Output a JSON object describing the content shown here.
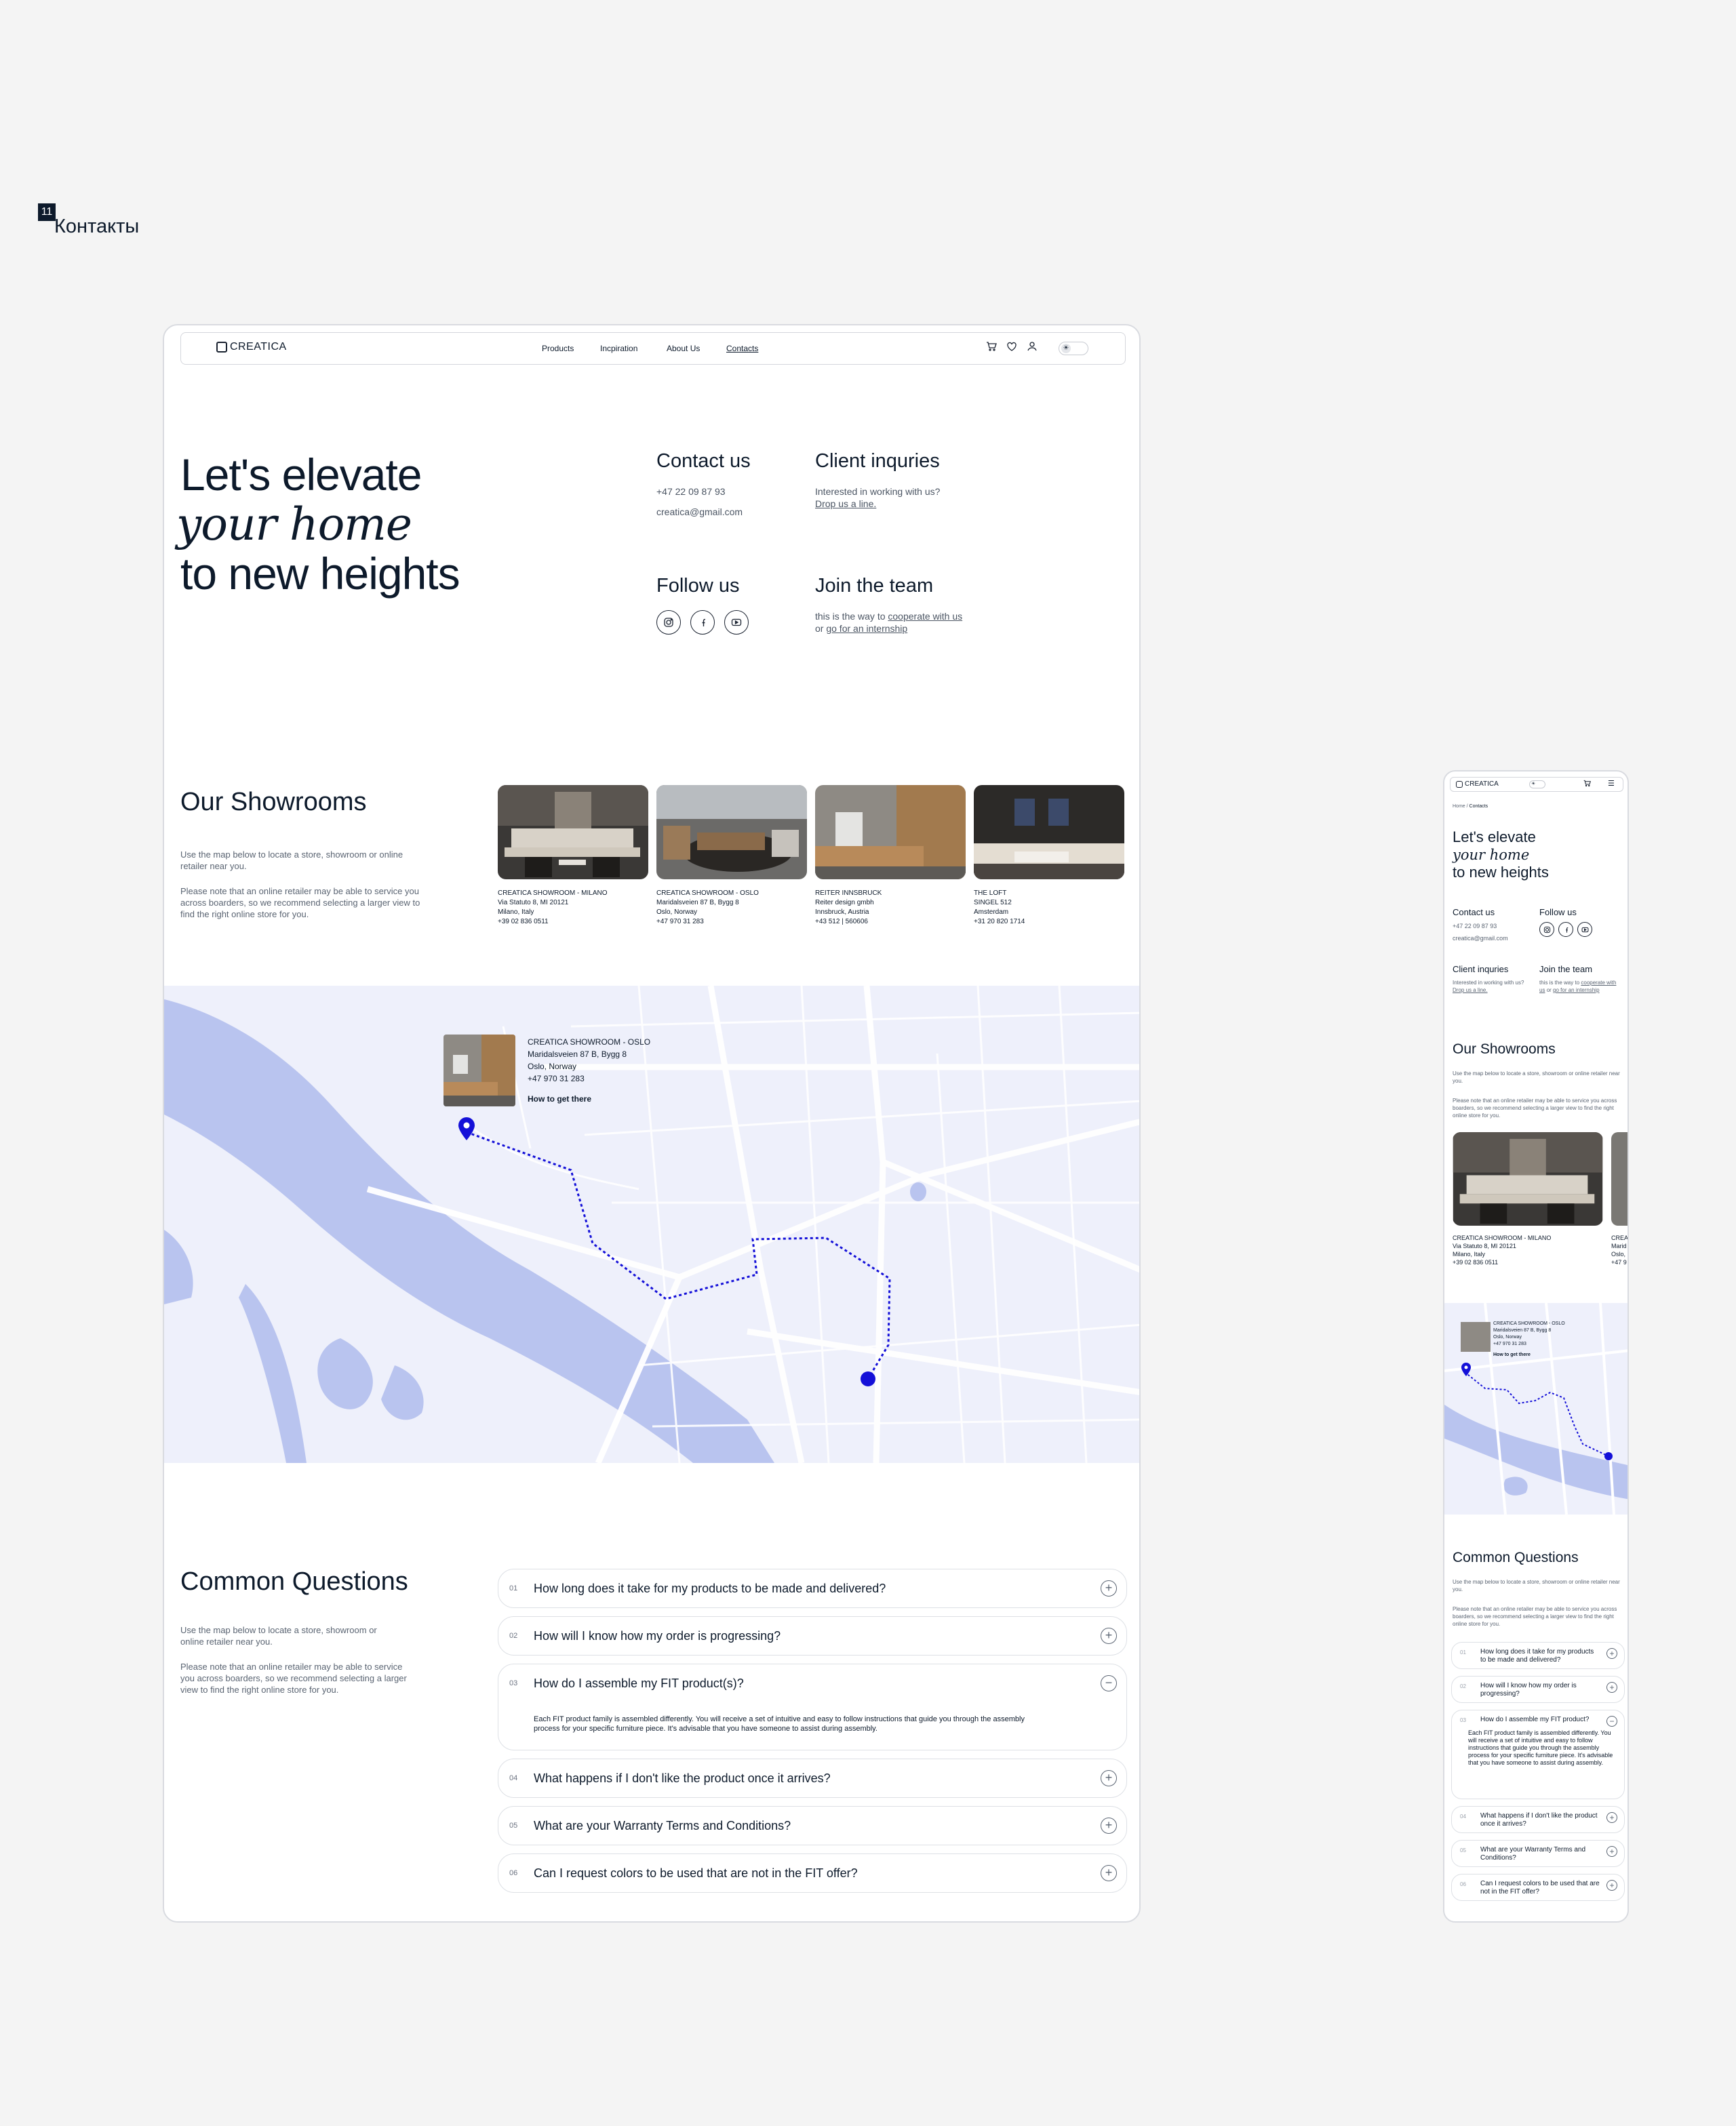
{
  "section": {
    "number": "11",
    "title": "Контакты"
  },
  "desktop": {
    "nav": {
      "logo": "CREATICA",
      "links": [
        "Products",
        "Incpiration",
        "About Us",
        "Contacts"
      ]
    },
    "hero": {
      "line1": "Let's elevate",
      "line2": "your home",
      "line3": "to new heights"
    },
    "contact": {
      "title": "Contact us",
      "phone": "+47 22 09 87 93",
      "email": "creatica@gmail.com"
    },
    "client": {
      "title": "Client inquries",
      "text": "Interested in working with us?",
      "link": "Drop us a line."
    },
    "follow": {
      "title": "Follow us"
    },
    "join": {
      "title": "Join the team",
      "text1": "this is the way to",
      "link1": "cooperate with us",
      "text2": "or",
      "link2": "go for an internship"
    },
    "showrooms": {
      "title": "Our Showrooms",
      "p1": "Use the map below to locate a store, showroom or online retailer near you.",
      "p2": "Please note that an online retailer may be able to service you across boarders, so we recommend selecting a larger view to find the right online store for you.",
      "cards": [
        {
          "name": "CREATICA SHOWROOM - MILANO",
          "l1": "Via Statuto 8, MI 20121",
          "l2": "Milano, Italy",
          "l3": "+39 02 836 0511"
        },
        {
          "name": "CREATICA SHOWROOM - OSLO",
          "l1": "Maridalsveien 87 B, Bygg 8",
          "l2": "Oslo, Norway",
          "l3": "+47 970 31 283"
        },
        {
          "name": "REITER INNSBRUCK",
          "l1": "Reiter design gmbh",
          "l2": "Innsbruck, Austria",
          "l3": "+43 512 | 560606"
        },
        {
          "name": "THE LOFT",
          "l1": "SINGEL 512",
          "l2": "Amsterdam",
          "l3": "+31 20 820 1714"
        }
      ]
    },
    "map": {
      "popup": {
        "name": "CREATICA SHOWROOM - OSLO",
        "l1": "Maridalsveien 87 B, Bygg 8",
        "l2": "Oslo, Norway",
        "l3": "+47 970 31 283",
        "cta": "How to get there"
      },
      "route_color": "#1410d8",
      "water_color": "#b9c4ef"
    },
    "faq": {
      "title": "Common Questions",
      "p1": "Use the map below to locate a store, showroom or online retailer near you.",
      "p2": "Please note that an online retailer may be able to service you across boarders, so we recommend selecting a larger view to find the right online store for you.",
      "items": [
        {
          "num": "01",
          "q": "How long does it take for my products to be made and delivered?"
        },
        {
          "num": "02",
          "q": "How will I know how my order is progressing?"
        },
        {
          "num": "03",
          "q": "How do I assemble my FIT product(s)?",
          "a": "Each FIT product family is assembled differently. You will receive a set of intuitive and easy to follow instructions that guide you through the assembly process for your specific furniture piece. It's advisable that you have someone to assist during assembly."
        },
        {
          "num": "04",
          "q": "What happens if I don't like the product once it arrives?"
        },
        {
          "num": "05",
          "q": "What are your Warranty Terms and Conditions?"
        },
        {
          "num": "06",
          "q": "Can I request colors to be used that are not in the FIT offer?"
        }
      ]
    }
  },
  "mobile": {
    "logo": "CREATICA",
    "breadcrumb": {
      "home": "Home",
      "sep": "/",
      "current": "Contacts"
    },
    "hero": {
      "line1": "Let's elevate",
      "line2": "your home",
      "line3": "to new heights"
    },
    "contact": {
      "title": "Contact us",
      "phone": "+47 22 09 87 93",
      "email": "creatica@gmail.com"
    },
    "follow": {
      "title": "Follow us"
    },
    "client": {
      "title": "Client inquries",
      "text": "Interested in working with us?",
      "link": "Drop us a line."
    },
    "join": {
      "title": "Join the team",
      "text1": "this is the way to",
      "link1": "cooperate with us",
      "text2": "or",
      "link2": "go for an internship"
    },
    "showrooms": {
      "title": "Our Showrooms",
      "p1": "Use the map below to locate a store, showroom or online retailer near you.",
      "p2": "Please note that an online retailer may be able to service you across boarders, so we recommend selecting a larger view to find the right online store for you.",
      "card": {
        "name": "CREATICA SHOWROOM - MILANO",
        "l1": "Via Statuto 8, MI 20121",
        "l2": "Milano, Italy",
        "l3": "+39 02 836 0511"
      },
      "peek": {
        "name": "CREA",
        "l1": "Marid",
        "l2": "Oslo,",
        "l3": "+47 9"
      }
    },
    "popup": {
      "name": "CREATICA SHOWROOM - OSLO",
      "l1": "Maridalsveien 87 B, Bygg 8",
      "l2": "Oslo, Norway",
      "l3": "+47 970 31 283",
      "cta": "How to get there"
    },
    "faq": {
      "title": "Common Questions",
      "p1": "Use the map below to locate a store, showroom or online retailer near you.",
      "p2": "Please note that an online retailer may be able to service you across boarders, so we recommend selecting a larger view to find the right online store for you.",
      "items": [
        {
          "num": "01",
          "q": "How long does it take for my products to be made and delivered?"
        },
        {
          "num": "02",
          "q": "How will I know how my order is progressing?"
        },
        {
          "num": "03",
          "q": "How do I assemble my FIT product?",
          "a": "Each FIT product family is assembled differently. You will receive a set of intuitive and easy to follow instructions that guide you through the assembly process for your specific furniture piece. It's advisable that you have someone to assist during assembly."
        },
        {
          "num": "04",
          "q": "What happens if I don't like the product once it arrives?"
        },
        {
          "num": "05",
          "q": "What are your Warranty Terms and Conditions?"
        },
        {
          "num": "06",
          "q": "Can I request colors to be used that are not in the FIT offer?"
        }
      ]
    }
  }
}
